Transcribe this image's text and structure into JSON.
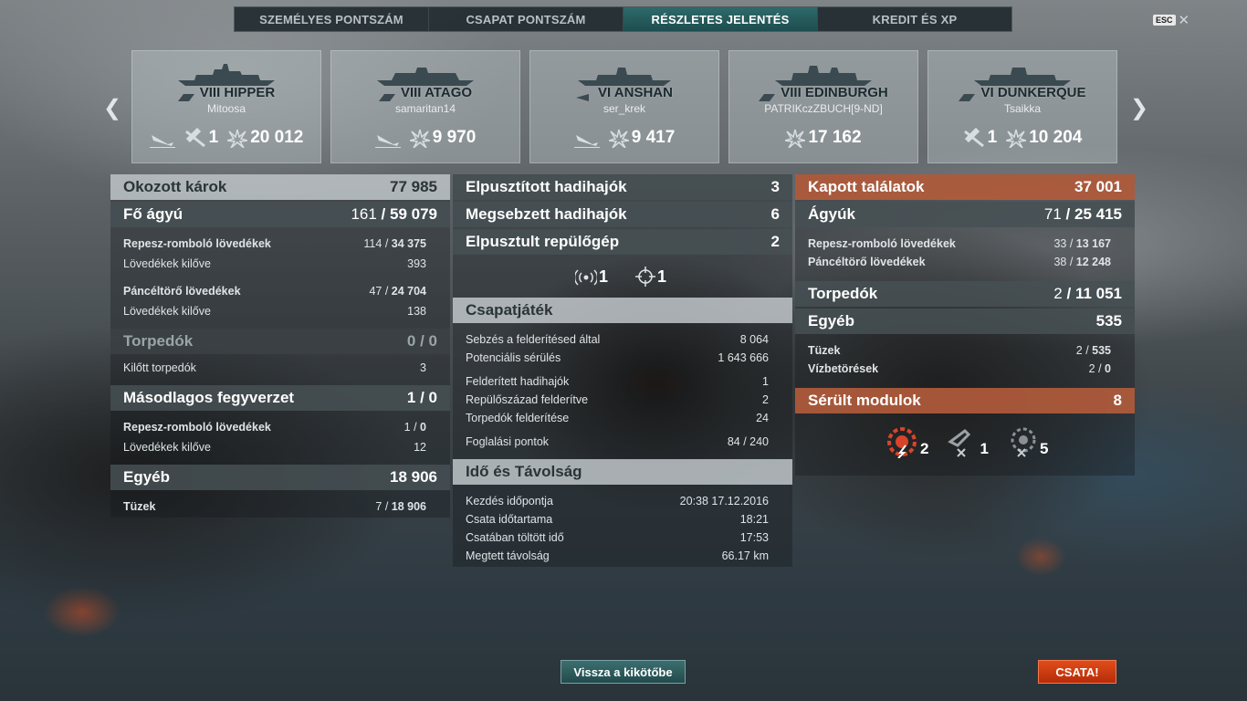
{
  "tabs": [
    "SZEMÉLYES PONTSZÁM",
    "CSAPAT PONTSZÁM",
    "RÉSZLETES JELENTÉS",
    "KREDIT ÉS XP"
  ],
  "active_tab": "RÉSZLETES JELENTÉS",
  "esc": {
    "key": "ESC",
    "icon": "close-icon"
  },
  "ships": [
    {
      "name": "VIII HIPPER",
      "player": "Mitoosa",
      "stats": [
        {
          "icon": "sunk-ship-icon",
          "value": ""
        },
        {
          "icon": "plane-shot-icon",
          "value": "1"
        },
        {
          "icon": "damage-icon",
          "value": "20 012"
        }
      ]
    },
    {
      "name": "VIII ATAGO",
      "player": "samaritan14",
      "stats": [
        {
          "icon": "sunk-ship-icon",
          "value": ""
        },
        {
          "icon": "damage-icon",
          "value": "9 970"
        }
      ]
    },
    {
      "name": "VI ANSHAN",
      "player": "ser_krek",
      "stats": [
        {
          "icon": "sunk-ship-icon",
          "value": ""
        },
        {
          "icon": "damage-icon",
          "value": "9 417"
        }
      ]
    },
    {
      "name": "VIII EDINBURGH",
      "player": "PATRIKczZBUCH[9-ND]",
      "stats": [
        {
          "icon": "damage-icon",
          "value": "17 162"
        }
      ]
    },
    {
      "name": "VI DUNKERQUE",
      "player": "Tsaikka",
      "stats": [
        {
          "icon": "plane-shot-icon",
          "value": "1"
        },
        {
          "icon": "damage-icon",
          "value": "10 204"
        }
      ]
    }
  ],
  "left": {
    "dealt": {
      "label": "Okozott károk",
      "value": "77 985"
    },
    "main": {
      "label": "Fő ágyú",
      "hits": "161",
      "dmg": "59 079"
    },
    "he": {
      "label": "Repesz-romboló lövedékek",
      "hits": "114",
      "dmg": "34 375"
    },
    "he_fired": {
      "label": "Lövedékek kilőve",
      "value": "393"
    },
    "ap": {
      "label": "Páncéltörő lövedékek",
      "hits": "47",
      "dmg": "24 704"
    },
    "ap_fired": {
      "label": "Lövedékek kilőve",
      "value": "138"
    },
    "torp": {
      "label": "Torpedók",
      "value": "0 / 0"
    },
    "torp_fired": {
      "label": "Kilőtt torpedók",
      "value": "3"
    },
    "sec": {
      "label": "Másodlagos fegyverzet",
      "value": "1 / 0"
    },
    "sec_he": {
      "label": "Repesz-romboló lövedékek",
      "hits": "1",
      "dmg": "0"
    },
    "sec_fired": {
      "label": "Lövedékek kilőve",
      "value": "12"
    },
    "other": {
      "label": "Egyéb",
      "value": "18 906"
    },
    "fires": {
      "label": "Tüzek",
      "hits": "7",
      "dmg": "18 906"
    }
  },
  "mid": {
    "destroyed": {
      "label": "Elpusztított hadihajók",
      "value": "3"
    },
    "damaged": {
      "label": "Megsebzett hadihajók",
      "value": "6"
    },
    "planes": {
      "label": "Elpusztult repülőgép",
      "value": "2"
    },
    "icons": [
      {
        "icon": "radio-signal-icon",
        "value": "1"
      },
      {
        "icon": "crosshair-icon",
        "value": "1"
      }
    ],
    "teamplay_title": "Csapatjáték",
    "teamplay": [
      {
        "label": "Sebzés a felderítésed által",
        "value": "8 064"
      },
      {
        "label": "Potenciális sérülés",
        "value": "1 643 666"
      },
      {
        "label": "Felderített hadihajók",
        "value": "1"
      },
      {
        "label": "Repülőszázad felderítve",
        "value": "2"
      },
      {
        "label": "Torpedók felderítése",
        "value": "24"
      },
      {
        "label": "Foglalási pontok",
        "value": "84 / 240"
      }
    ],
    "time_title": "Idő és Távolság",
    "time": [
      {
        "label": "Kezdés időpontja",
        "value": "20:38  17.12.2016"
      },
      {
        "label": "Csata időtartama",
        "value": "18:21"
      },
      {
        "label": "Csatában töltött idő",
        "value": "17:53"
      },
      {
        "label": "Megtett távolság",
        "value": "66.17 km"
      }
    ]
  },
  "right": {
    "received": {
      "label": "Kapott találatok",
      "value": "37 001"
    },
    "guns": {
      "label": "Ágyúk",
      "hits": "71",
      "dmg": "25 415"
    },
    "he": {
      "label": "Repesz-romboló lövedékek",
      "hits": "33",
      "dmg": "13 167"
    },
    "ap": {
      "label": "Páncéltörő lövedékek",
      "hits": "38",
      "dmg": "12 248"
    },
    "torp": {
      "label": "Torpedók",
      "hits": "2",
      "dmg": "11 051"
    },
    "other": {
      "label": "Egyéb",
      "value": "535"
    },
    "fires": {
      "label": "Tüzek",
      "hits": "2",
      "dmg": "535"
    },
    "flood": {
      "label": "Vízbetörések",
      "hits": "2",
      "dmg": "0"
    },
    "modules": {
      "label": "Sérült modulok",
      "value": "8"
    },
    "module_icons": [
      {
        "icon": "engine-module-icon",
        "value": "2"
      },
      {
        "icon": "gun-module-icon",
        "value": "1"
      },
      {
        "icon": "turret-module-icon",
        "value": "5"
      }
    ]
  },
  "buttons": {
    "back": "Vissza a kikötőbe",
    "battle": "CSATA!"
  },
  "colors": {
    "accent": "#1d4d50",
    "orange_header": "#b45c3c",
    "battle": "#d03a10"
  }
}
